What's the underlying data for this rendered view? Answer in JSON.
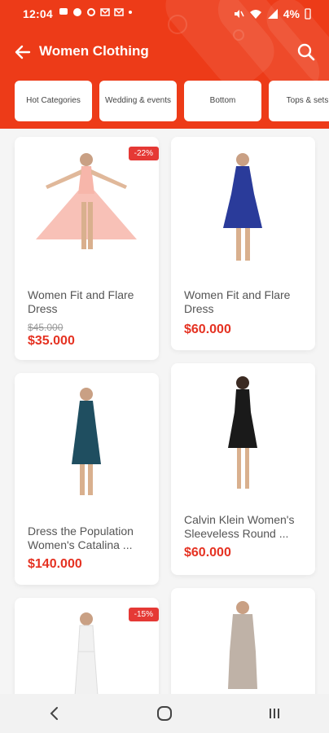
{
  "status_bar": {
    "time": "12:04",
    "battery": "4%"
  },
  "appbar": {
    "title": "Women Clothing"
  },
  "categories": [
    {
      "label": "Hot Categories"
    },
    {
      "label": "Wedding & events"
    },
    {
      "label": "Bottom"
    },
    {
      "label": "Tops & sets"
    }
  ],
  "products": [
    {
      "name": "Women Fit and Flare Dress",
      "old_price": "$45.000",
      "price": "$35.000",
      "discount": "-22%",
      "dress_color": "#f7b6aa"
    },
    {
      "name": "Women Fit and Flare Dress",
      "price": "$60.000",
      "dress_color": "#2a3b9a"
    },
    {
      "name": "Dress the Population Women's Catalina ...",
      "price": "$140.000",
      "dress_color": "#1f4e60"
    },
    {
      "name": "Calvin Klein Women's Sleeveless Round ...",
      "price": "$60.000",
      "dress_color": "#1a1a1a"
    },
    {
      "discount": "-15%",
      "dress_color": "#f1f1f1"
    },
    {
      "dress_color": "#bfb2a7"
    }
  ]
}
